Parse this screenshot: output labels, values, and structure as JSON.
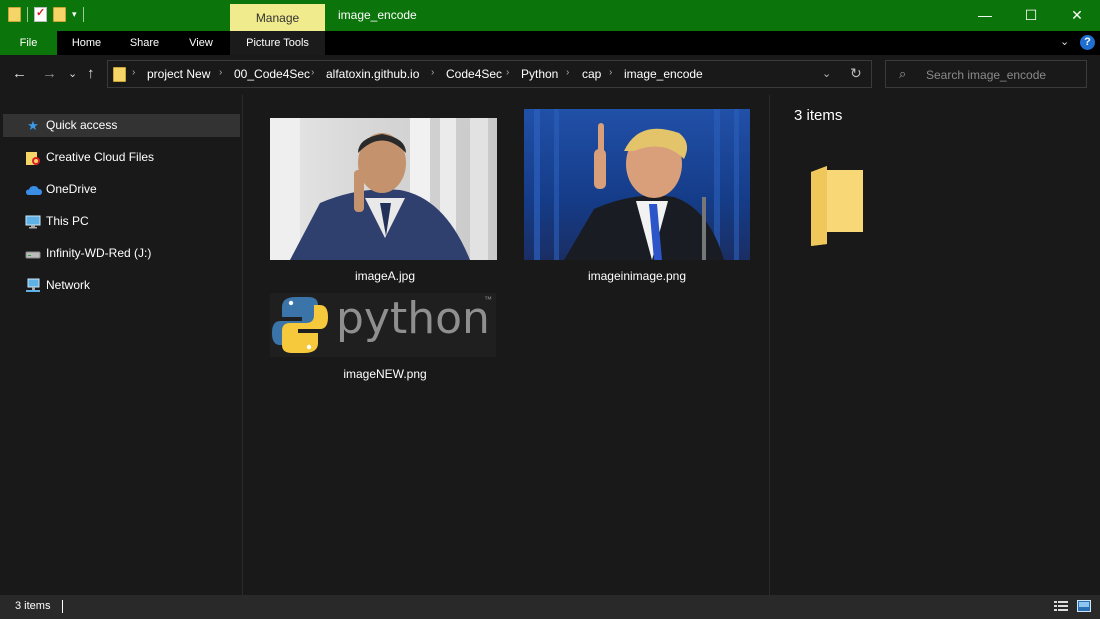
{
  "window": {
    "title": "image_encode",
    "context_tab": "Manage",
    "controls": {
      "minimize": "—",
      "maximize": "☐",
      "close": "✕"
    }
  },
  "quick_access_toolbar": {
    "dropdown": "▾"
  },
  "ribbon": {
    "tabs": [
      "File",
      "Home",
      "Share",
      "View",
      "Picture Tools"
    ],
    "collapse": "⌄",
    "help": "?"
  },
  "navigation": {
    "back": "←",
    "forward": "→",
    "recent": "⌄",
    "up": "↑"
  },
  "address_bar": {
    "path": [
      "project New",
      "00_Code4Sec",
      "alfatoxin.github.io",
      "Code4Sec",
      "Python",
      "cap",
      "image_encode"
    ],
    "separator": "›",
    "dropdown": "⌄",
    "refresh": "↻"
  },
  "search": {
    "icon": "⌕",
    "placeholder": "Search image_encode"
  },
  "sidebar": {
    "items": [
      {
        "label": "Quick access",
        "icon": "star-icon",
        "glyph": "★",
        "color": "#3c9be8",
        "selected": true
      },
      {
        "label": "Creative Cloud Files",
        "icon": "creative-cloud-folder-icon",
        "glyph": "",
        "color": "#f5d468",
        "selected": false
      },
      {
        "label": "OneDrive",
        "icon": "onedrive-cloud-icon",
        "glyph": "☁",
        "color": "#3a8ee6",
        "selected": false
      },
      {
        "label": "This PC",
        "icon": "computer-icon",
        "glyph": "",
        "color": "#5fb2e6",
        "selected": false
      },
      {
        "label": "Infinity-WD-Red (J:)",
        "icon": "drive-icon",
        "glyph": "",
        "color": "#cccccc",
        "selected": false
      },
      {
        "label": "Network",
        "icon": "network-icon",
        "glyph": "",
        "color": "#5fb2e6",
        "selected": false
      }
    ]
  },
  "files": [
    {
      "name": "imageA.jpg"
    },
    {
      "name": "imageinimage.png"
    },
    {
      "name": "imageNEW.png",
      "logo_text": "python",
      "trademark": "™"
    }
  ],
  "preview_pane": {
    "item_count": "3 items"
  },
  "status_bar": {
    "item_count": "3 items"
  },
  "colors": {
    "titlebar": "#0b750b",
    "manage_tab": "#f0eb8c",
    "background": "#191919",
    "selection": "#333333"
  }
}
